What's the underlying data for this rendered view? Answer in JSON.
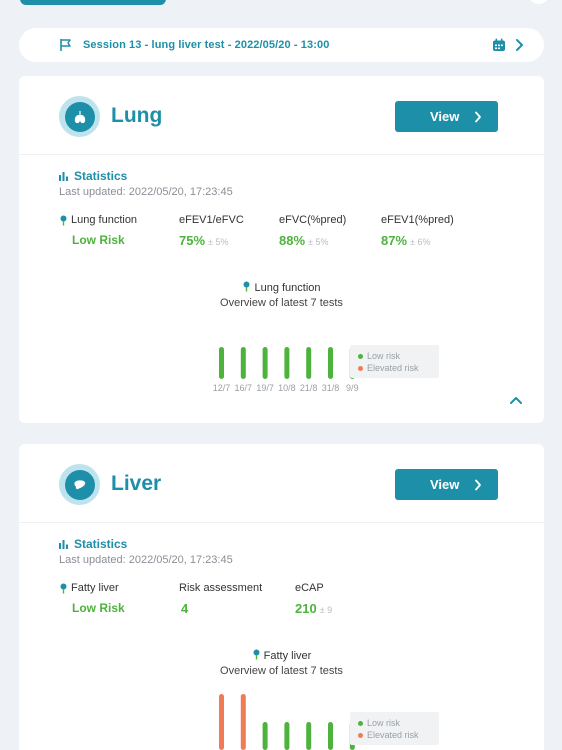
{
  "session": {
    "label": "Session 13 - lung liver test - 2022/05/20 - 13:00"
  },
  "colors": {
    "brand": "#1e8fa8",
    "low_risk": "#4db33d",
    "elevated_risk": "#ef7c57"
  },
  "icons": {
    "session": "flag-icon",
    "calendar": "calendar-icon",
    "chevron": "chevron-right-icon",
    "stats": "bar-chart-icon",
    "function": "lungs-icon",
    "collapse": "chevron-up-icon"
  },
  "lung": {
    "title": "Lung",
    "view_label": "View",
    "stats_title": "Statistics",
    "updated": "Last updated: 2022/05/20, 17:23:45",
    "risk_label": "Lung function",
    "risk_value": "Low Risk",
    "metrics": [
      {
        "label": "eFEV1/eFVC",
        "value": "75%",
        "pm": "± 5%"
      },
      {
        "label": "eFVC(%pred)",
        "value": "88%",
        "pm": "± 5%"
      },
      {
        "label": "eFEV1(%pred)",
        "value": "87%",
        "pm": "± 6%"
      }
    ],
    "chart_title": "Lung function",
    "chart_subtitle": "Overview of latest 7 tests"
  },
  "liver": {
    "title": "Liver",
    "view_label": "View",
    "stats_title": "Statistics",
    "updated": "Last updated: 2022/05/20, 17:23:45",
    "risk_label": "Fatty liver",
    "risk_value": "Low Risk",
    "metrics": [
      {
        "label": "Risk assessment",
        "value": "4",
        "pm": ""
      },
      {
        "label": "eCAP",
        "value": "210",
        "pm": "± 9"
      }
    ],
    "chart_title": "Fatty liver",
    "chart_subtitle": "Overview of latest 7 tests"
  },
  "legend": {
    "low": "Low risk",
    "elevated": "Elevated risk"
  },
  "chart_data": [
    {
      "type": "bar",
      "title": "Lung function",
      "subtitle": "Overview of latest 7 tests",
      "categories": [
        "12/7",
        "16/7",
        "19/7",
        "10/8",
        "21/8",
        "31/8",
        "9/9"
      ],
      "values": [
        1,
        1,
        1,
        1,
        1,
        1,
        1
      ],
      "risk": [
        "low",
        "low",
        "low",
        "low",
        "low",
        "low",
        "low"
      ],
      "legend": [
        "Low risk",
        "Elevated risk"
      ],
      "legend_position": "right"
    },
    {
      "type": "bar",
      "title": "Fatty liver",
      "subtitle": "Overview of latest 7 tests",
      "categories": [],
      "values": [
        2,
        2,
        1,
        1,
        1,
        1,
        1
      ],
      "risk": [
        "elevated",
        "elevated",
        "low",
        "low",
        "low",
        "low",
        "low"
      ],
      "legend": [
        "Low risk",
        "Elevated risk"
      ],
      "legend_position": "right"
    }
  ]
}
